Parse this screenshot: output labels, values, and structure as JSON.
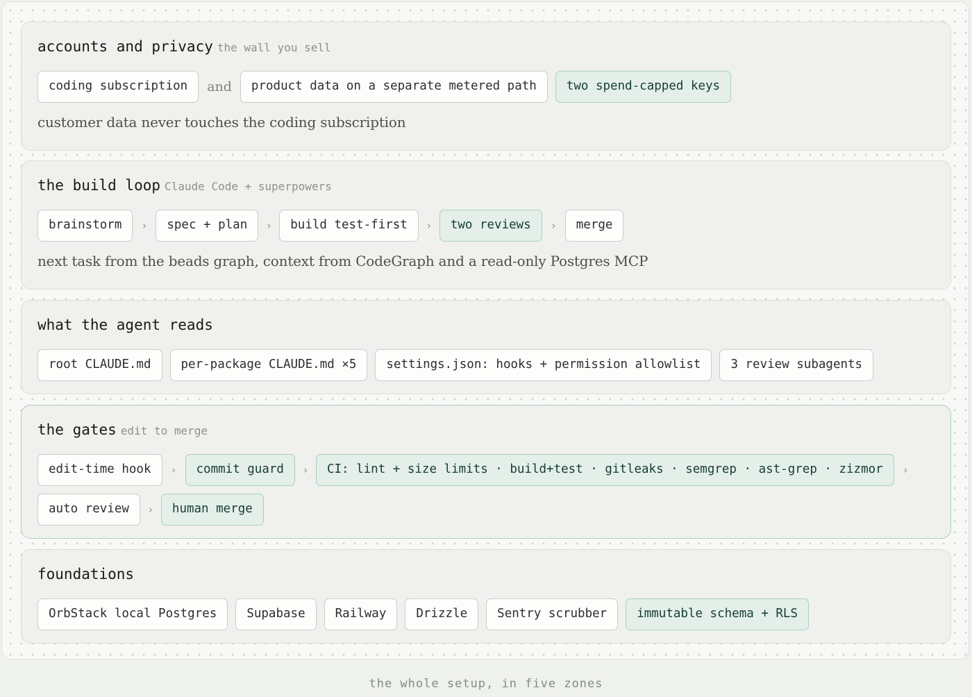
{
  "zones": [
    {
      "title": "accounts and privacy",
      "subtitle": "the wall you sell",
      "items": [
        "coding subscription",
        "and",
        "product data on a separate metered path",
        "two spend-capped keys"
      ],
      "note": "customer data never touches the coding subscription"
    },
    {
      "title": "the build loop",
      "subtitle": "Claude Code + superpowers",
      "steps": [
        "brainstorm",
        "spec + plan",
        "build test-first",
        "two reviews",
        "merge"
      ],
      "note": "next task from the beads graph, context from CodeGraph and a read-only Postgres MCP"
    },
    {
      "title": "what the agent reads",
      "items": [
        "root CLAUDE.md",
        "per-package CLAUDE.md ×5",
        "settings.json: hooks + permission allowlist",
        "3 review subagents"
      ]
    },
    {
      "title": "the gates",
      "subtitle": "edit to merge",
      "steps": [
        "edit-time hook",
        "commit guard",
        "CI: lint + size limits · build+test · gitleaks · semgrep · ast-grep · zizmor",
        "auto review",
        "human merge"
      ]
    },
    {
      "title": "foundations",
      "items": [
        "OrbStack local Postgres",
        "Supabase",
        "Railway",
        "Drizzle",
        "Sentry scrubber",
        "immutable schema + RLS"
      ]
    }
  ],
  "arrow_glyph": "›",
  "caption": "the whole setup, in five zones",
  "colors": {
    "background": "#eff1ed",
    "zone_fill": "#f0f1ee",
    "highlight_fill": "#e4efe9",
    "highlight_border": "#a9cfc1",
    "highlight_text": "#163d31"
  }
}
